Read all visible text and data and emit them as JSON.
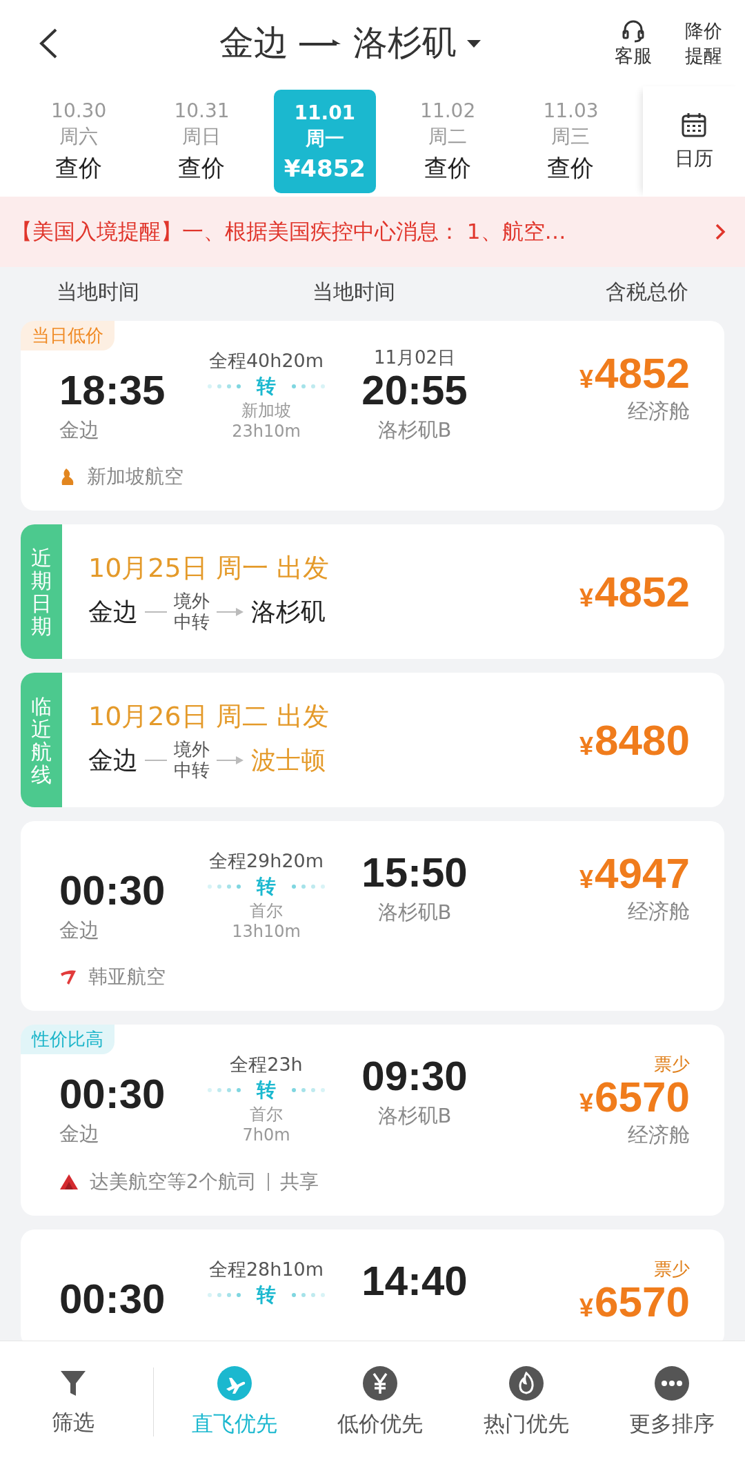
{
  "header": {
    "from": "金边",
    "to": "洛杉矶",
    "service": "客服",
    "price_alert": "降价提醒"
  },
  "dates": [
    {
      "date": "10.30",
      "weekday": "周六",
      "price": "查价",
      "selected": false
    },
    {
      "date": "10.31",
      "weekday": "周日",
      "price": "查价",
      "selected": false
    },
    {
      "date": "11.01",
      "weekday": "周一",
      "price": "¥4852",
      "selected": true
    },
    {
      "date": "11.02",
      "weekday": "周二",
      "price": "查价",
      "selected": false
    },
    {
      "date": "11.03",
      "weekday": "周三",
      "price": "查价",
      "selected": false
    }
  ],
  "calendar": "日历",
  "notice": "【美国入境提醒】一、根据美国疾控中心消息： 1、航空…",
  "columns": [
    "当地时间",
    "当地时间",
    "含税总价"
  ],
  "cards": [
    {
      "kind": "flight",
      "tag": {
        "text": "当日低价",
        "color": "#f08a24"
      },
      "dep_time": "18:35",
      "dep_city": "金边",
      "duration": "全程40h20m",
      "transfer": "转",
      "stop_city": "新加坡",
      "stop_time": "23h10m",
      "arr_date": "11月02日",
      "arr_time": "20:55",
      "arr_city": "洛杉矶B",
      "price": "4852",
      "currency": "¥",
      "cabin": "经济舱",
      "airline": "新加坡航空"
    },
    {
      "kind": "suggestion",
      "side": "近期日期",
      "date_line": "10月25日 周一 出发",
      "from": "金边",
      "via": [
        "境外",
        "中转"
      ],
      "to": "洛杉矶",
      "to_highlight": false,
      "currency": "¥",
      "price": "4852"
    },
    {
      "kind": "suggestion",
      "side": "临近航线",
      "date_line": "10月26日 周二 出发",
      "from": "金边",
      "via": [
        "境外",
        "中转"
      ],
      "to": "波士顿",
      "to_highlight": true,
      "currency": "¥",
      "price": "8480"
    },
    {
      "kind": "flight",
      "dep_time": "00:30",
      "dep_city": "金边",
      "duration": "全程29h20m",
      "transfer": "转",
      "stop_city": "首尔",
      "stop_time": "13h10m",
      "arr_time": "15:50",
      "arr_city": "洛杉矶B",
      "price": "4947",
      "currency": "¥",
      "cabin": "经济舱",
      "airline": "韩亚航空"
    },
    {
      "kind": "flight",
      "tag": {
        "text": "性价比高",
        "color": "#1cb5c9"
      },
      "dep_time": "00:30",
      "dep_city": "金边",
      "duration": "全程23h",
      "transfer": "转",
      "stop_city": "首尔",
      "stop_time": "7h0m",
      "arr_time": "09:30",
      "arr_city": "洛杉矶B",
      "note": "票少",
      "price": "6570",
      "currency": "¥",
      "cabin": "经济舱",
      "airline": "达美航空等2个航司",
      "share": "共享"
    },
    {
      "kind": "flight",
      "dep_time": "00:30",
      "duration": "全程28h10m",
      "transfer": "转",
      "arr_time": "14:40",
      "note": "票少",
      "price": "6570",
      "currency": "¥"
    }
  ],
  "sort_tabs": [
    {
      "label": "筛选",
      "selected": false
    },
    {
      "label": "直飞优先",
      "selected": true
    },
    {
      "label": "低价优先",
      "selected": false
    },
    {
      "label": "热门优先",
      "selected": false
    },
    {
      "label": "更多排序",
      "selected": false
    }
  ]
}
